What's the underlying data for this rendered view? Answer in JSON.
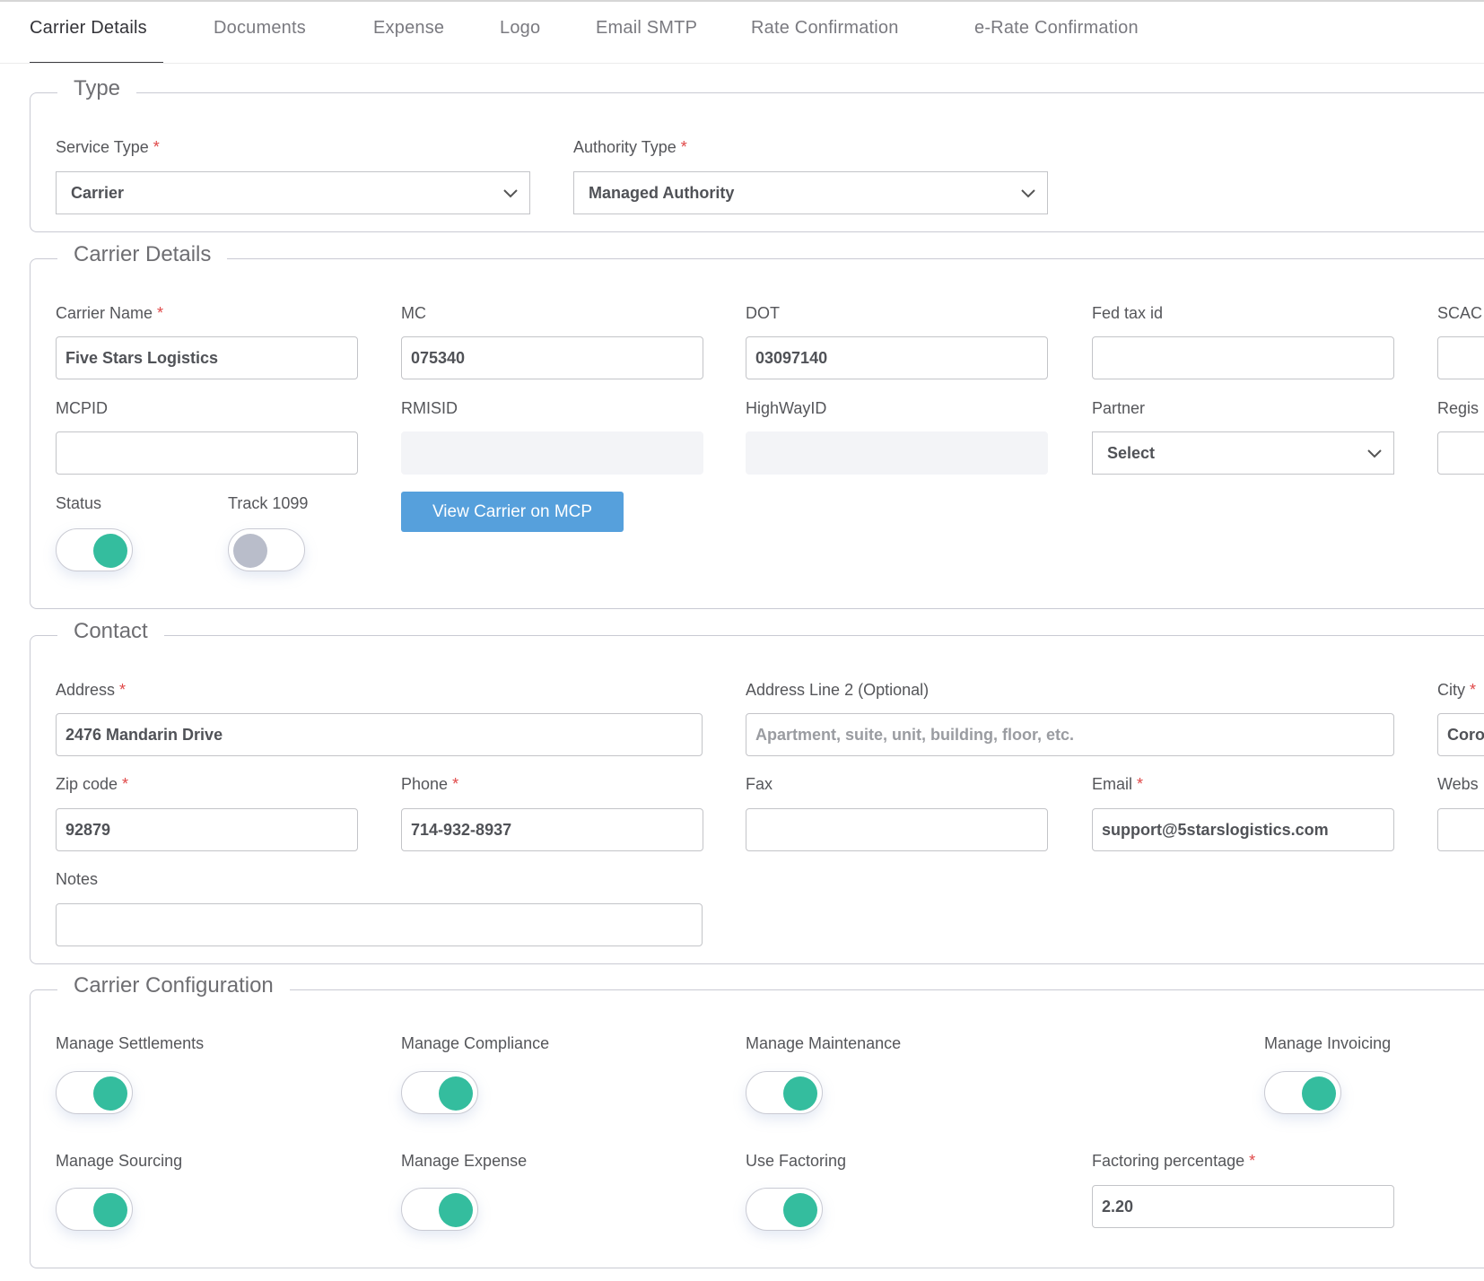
{
  "tabs": [
    {
      "label": "Carrier Details",
      "active": true
    },
    {
      "label": "Documents",
      "active": false
    },
    {
      "label": "Expense",
      "active": false
    },
    {
      "label": "Logo",
      "active": false
    },
    {
      "label": "Email SMTP",
      "active": false
    },
    {
      "label": "Rate Confirmation",
      "active": false
    },
    {
      "label": "e-Rate Confirmation",
      "active": false
    }
  ],
  "type_section": {
    "legend": "Type",
    "service_type": {
      "label": "Service Type",
      "required": "*",
      "value": "Carrier"
    },
    "authority_type": {
      "label": "Authority Type",
      "required": "*",
      "value": "Managed Authority"
    }
  },
  "carrier_details": {
    "legend": "Carrier Details",
    "carrier_name": {
      "label": "Carrier Name",
      "required": "*",
      "value": "Five Stars Logistics"
    },
    "mc": {
      "label": "MC",
      "value": "075340"
    },
    "dot": {
      "label": "DOT",
      "value": "03097140"
    },
    "fed_tax_id": {
      "label": "Fed tax id",
      "value": ""
    },
    "scac": {
      "label": "SCAC",
      "value": ""
    },
    "mcpid": {
      "label": "MCPID",
      "value": ""
    },
    "rmisid": {
      "label": "RMISID",
      "value": ""
    },
    "highwayid": {
      "label": "HighWayID",
      "value": ""
    },
    "partner": {
      "label": "Partner",
      "value": "Select"
    },
    "regis": {
      "label": "Regis",
      "value": ""
    },
    "status": {
      "label": "Status",
      "on": true
    },
    "track1099": {
      "label": "Track 1099",
      "on": false
    },
    "view_mcp_button": "View Carrier on MCP"
  },
  "contact": {
    "legend": "Contact",
    "address": {
      "label": "Address",
      "required": "*",
      "value": "2476 Mandarin Drive"
    },
    "address2": {
      "label": "Address Line 2 (Optional)",
      "placeholder": "Apartment, suite, unit, building, floor, etc."
    },
    "city": {
      "label": "City",
      "required": "*",
      "value": "Coro"
    },
    "zip": {
      "label": "Zip code",
      "required": "*",
      "value": "92879"
    },
    "phone": {
      "label": "Phone",
      "required": "*",
      "value": "714-932-8937"
    },
    "fax": {
      "label": "Fax",
      "value": ""
    },
    "email": {
      "label": "Email",
      "required": "*",
      "value": "support@5starslogistics.com"
    },
    "website": {
      "label": "Webs",
      "value": ""
    },
    "notes": {
      "label": "Notes",
      "value": ""
    }
  },
  "configuration": {
    "legend": "Carrier Configuration",
    "manage_settlements": {
      "label": "Manage Settlements",
      "on": true
    },
    "manage_compliance": {
      "label": "Manage Compliance",
      "on": true
    },
    "manage_maintenance": {
      "label": "Manage Maintenance",
      "on": true
    },
    "manage_invoicing": {
      "label": "Manage Invoicing",
      "on": true
    },
    "manage_sourcing": {
      "label": "Manage Sourcing",
      "on": true
    },
    "manage_expense": {
      "label": "Manage Expense",
      "on": true
    },
    "use_factoring": {
      "label": "Use Factoring",
      "on": true
    },
    "factoring_percentage": {
      "label": "Factoring percentage",
      "required": "*",
      "value": "2.20"
    }
  },
  "colors": {
    "accent": "#56a0dc",
    "toggle_on": "#34bd9e",
    "toggle_off": "#b9bdca",
    "required": "#e04848"
  }
}
